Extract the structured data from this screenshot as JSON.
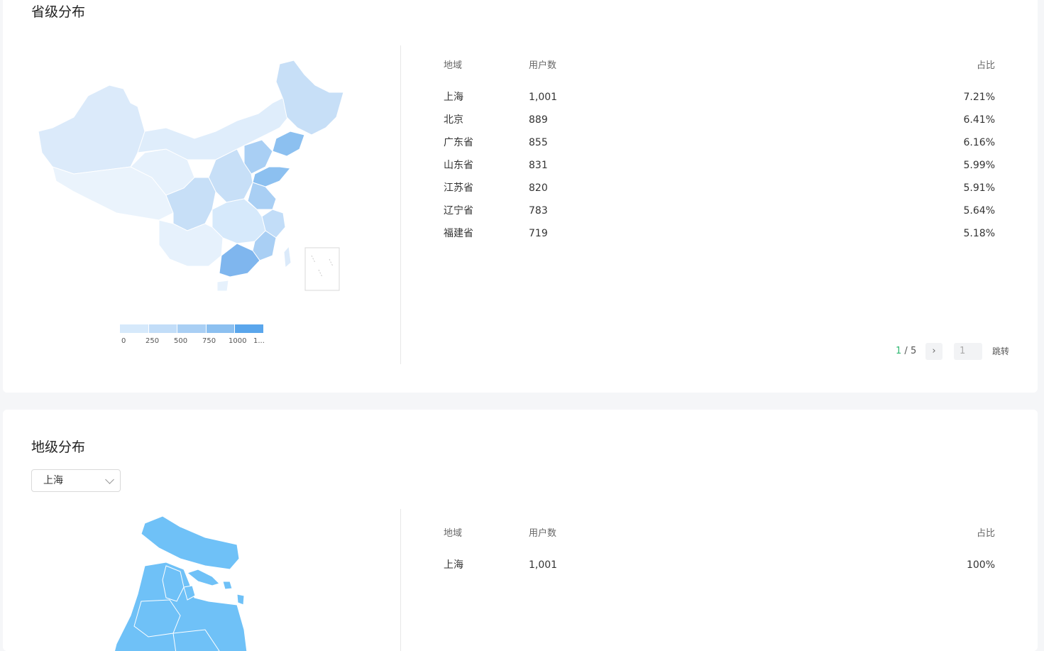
{
  "province_section": {
    "title": "省级分布",
    "table": {
      "headers": [
        "地域",
        "用户数",
        "占比"
      ],
      "rows": [
        {
          "region": "上海",
          "users": "1,001",
          "ratio": "7.21%"
        },
        {
          "region": "北京",
          "users": "889",
          "ratio": "6.41%"
        },
        {
          "region": "广东省",
          "users": "855",
          "ratio": "6.16%"
        },
        {
          "region": "山东省",
          "users": "831",
          "ratio": "5.99%"
        },
        {
          "region": "江苏省",
          "users": "820",
          "ratio": "5.91%"
        },
        {
          "region": "辽宁省",
          "users": "783",
          "ratio": "5.64%"
        },
        {
          "region": "福建省",
          "users": "719",
          "ratio": "5.18%"
        }
      ]
    },
    "pager": {
      "current": "1",
      "separator": " / ",
      "total": "5",
      "next_icon": "chevron-right-icon",
      "next_glyph": "›",
      "input_value": "1",
      "jump_label": "跳转"
    },
    "legend": {
      "labels": [
        "0",
        "250",
        "500",
        "750",
        "1000",
        "1..."
      ],
      "colors": [
        "#e6f1fc",
        "#d6e9fb",
        "#c2ddf8",
        "#a9cff4",
        "#8cc0f0",
        "#5aa6ec"
      ]
    },
    "map_colors": {
      "lightest": "#eaf3fc",
      "light": "#dbeafa",
      "mid": "#c7dff7",
      "darker": "#a9cdf3",
      "darkest": "#7fb6ee",
      "border": "#ffffff"
    }
  },
  "city_section": {
    "title": "地级分布",
    "select": {
      "value": "上海",
      "icon": "chevron-down-icon"
    },
    "table": {
      "headers": [
        "地域",
        "用户数",
        "占比"
      ],
      "rows": [
        {
          "region": "上海",
          "users": "1,001",
          "ratio": "100%"
        }
      ]
    },
    "map_color": "#6fc1f7"
  }
}
